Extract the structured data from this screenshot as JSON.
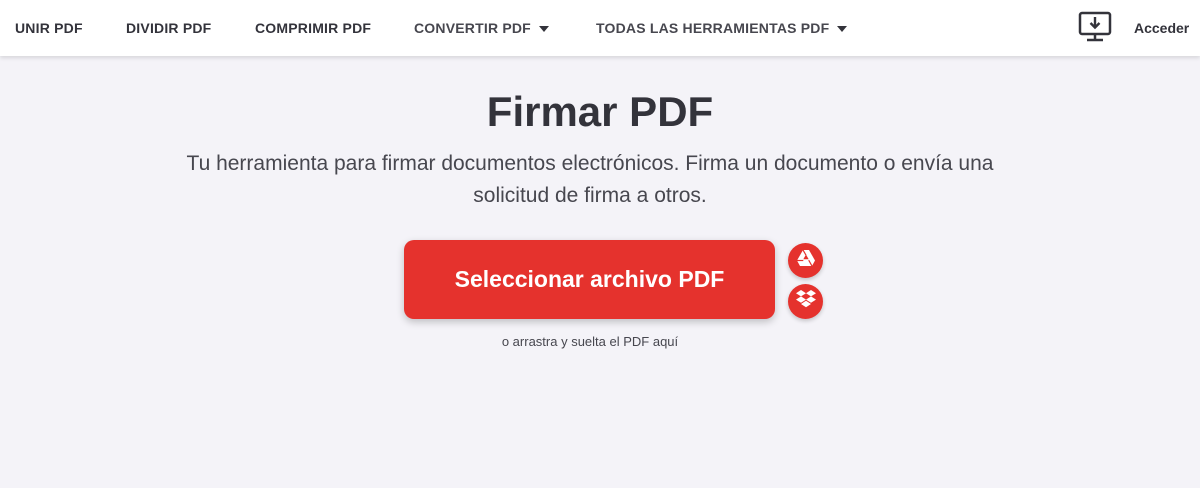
{
  "nav": {
    "items": [
      {
        "label": "UNIR PDF"
      },
      {
        "label": "DIVIDIR PDF"
      },
      {
        "label": "COMPRIMIR PDF"
      },
      {
        "label": "CONVERTIR PDF"
      },
      {
        "label": "TODAS LAS HERRAMIENTAS PDF"
      }
    ],
    "login_label": "Acceder",
    "desktop_icon": "desktop-download-icon",
    "caret_icon": "caret-down-icon"
  },
  "hero": {
    "title": "Firmar PDF",
    "subtitle": "Tu herramienta para firmar documentos electrónicos. Firma un documento o envía una solicitud de firma a otros."
  },
  "upload": {
    "button_label": "Seleccionar archivo PDF",
    "drop_hint": "o arrastra y suelta el PDF aquí",
    "cloud_icons": [
      "google-drive-icon",
      "dropbox-icon"
    ]
  },
  "colors": {
    "accent": "#e5322d",
    "background": "#f4f3f8",
    "text": "#33333b"
  }
}
